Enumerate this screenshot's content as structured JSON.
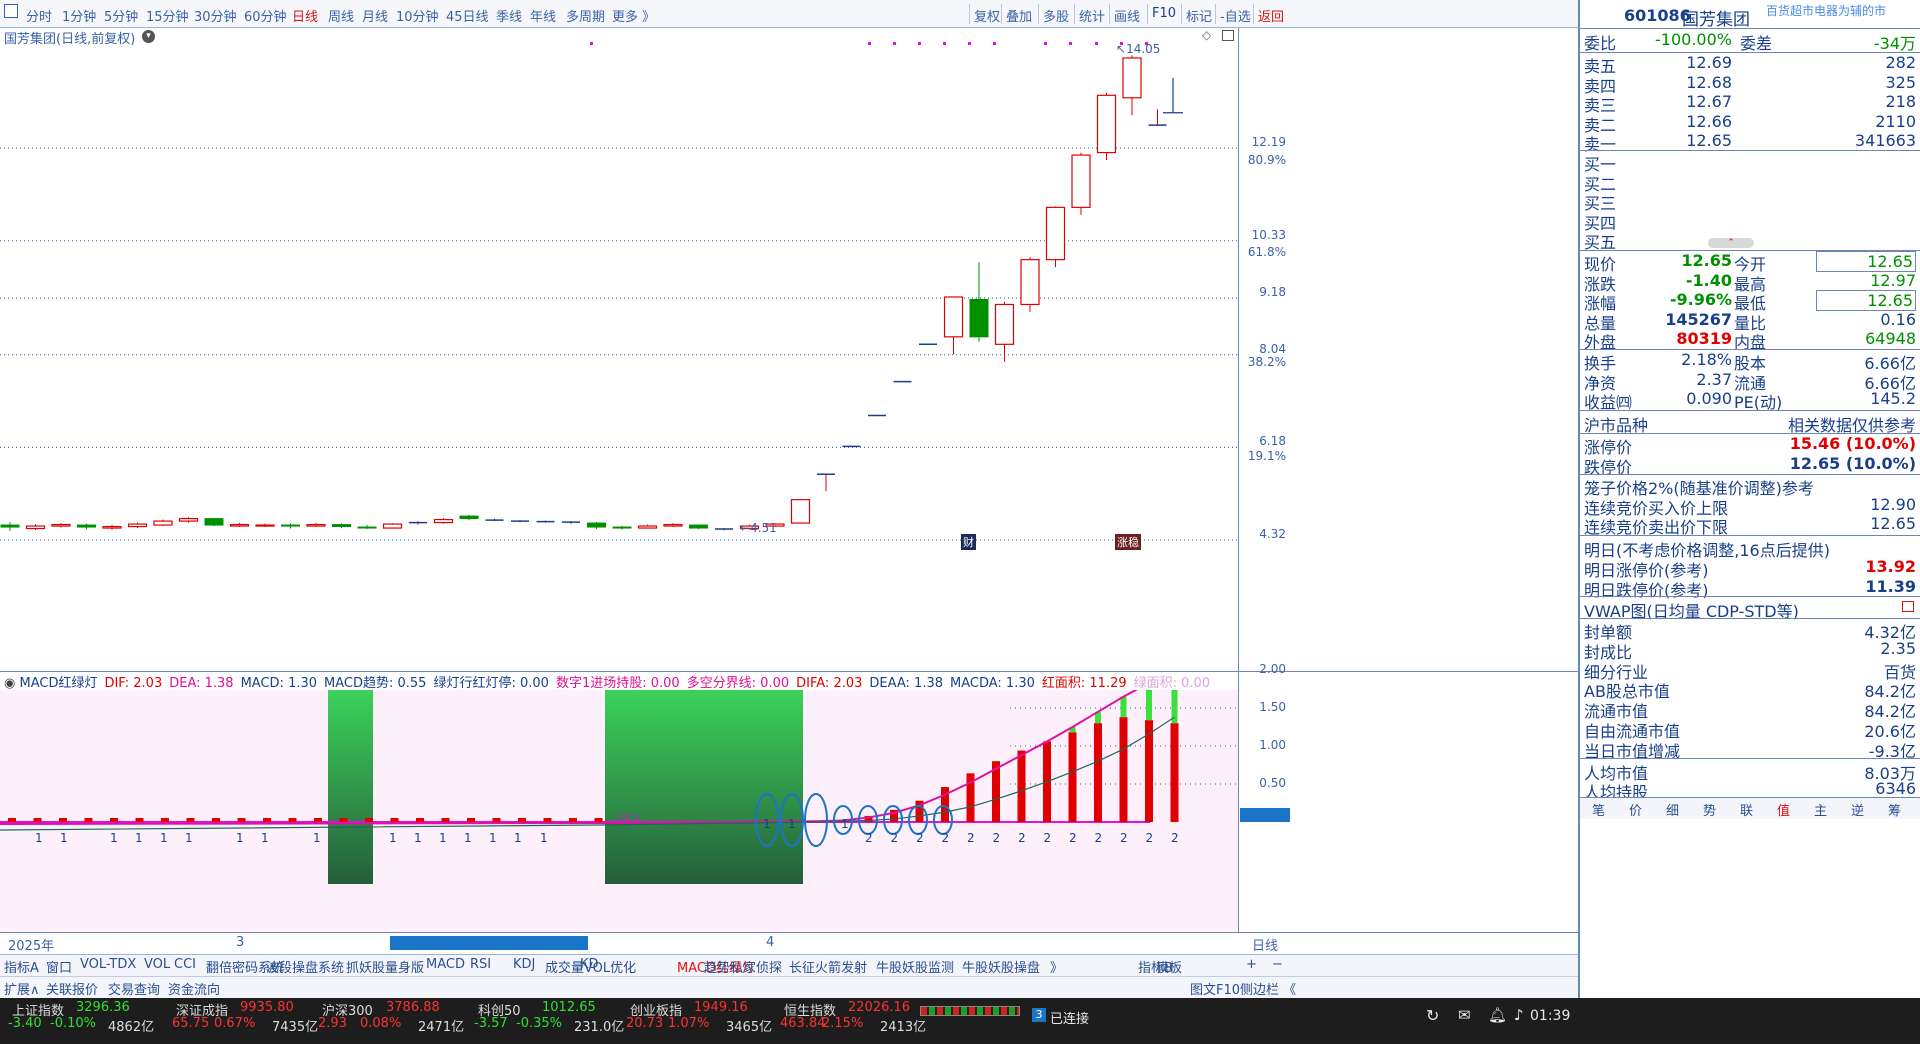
{
  "toolbar": {
    "period_tabs": [
      "分时",
      "1分钟",
      "5分钟",
      "15分钟",
      "30分钟",
      "60分钟",
      "日线",
      "周线",
      "月线",
      "10分钟",
      "45日线",
      "季线",
      "年线",
      "多周期",
      "更多 》"
    ],
    "selected": "日线",
    "right_tabs": [
      "复权",
      "叠加",
      "多股",
      "统计",
      "画线",
      "F10",
      "标记",
      "-自选",
      "返回"
    ]
  },
  "main_chart": {
    "title": "国芳集团(日线,前复权)",
    "price_labels": [
      "12.19",
      "10.33",
      "9.18",
      "8.04",
      "6.18",
      "4.32"
    ],
    "pct_labels": [
      "80.9%",
      "61.8%",
      "38.2%",
      "19.1%"
    ],
    "high_marker": "14.05",
    "low_marker": "4.51",
    "badge_cai": "财",
    "badge_zhang": "涨稳"
  },
  "chart_data": {
    "type": "candlestick",
    "candles": [
      {
        "o": 4.62,
        "c": 4.58,
        "h": 4.68,
        "l": 4.5
      },
      {
        "o": 4.55,
        "c": 4.6,
        "h": 4.64,
        "l": 4.52
      },
      {
        "o": 4.6,
        "c": 4.63,
        "h": 4.66,
        "l": 4.57
      },
      {
        "o": 4.62,
        "c": 4.58,
        "h": 4.65,
        "l": 4.53
      },
      {
        "o": 4.56,
        "c": 4.59,
        "h": 4.62,
        "l": 4.53
      },
      {
        "o": 4.59,
        "c": 4.64,
        "h": 4.67,
        "l": 4.56
      },
      {
        "o": 4.62,
        "c": 4.7,
        "h": 4.73,
        "l": 4.6
      },
      {
        "o": 4.7,
        "c": 4.75,
        "h": 4.78,
        "l": 4.67
      },
      {
        "o": 4.75,
        "c": 4.62,
        "h": 4.76,
        "l": 4.6
      },
      {
        "o": 4.6,
        "c": 4.63,
        "h": 4.66,
        "l": 4.58
      },
      {
        "o": 4.6,
        "c": 4.62,
        "h": 4.65,
        "l": 4.58
      },
      {
        "o": 4.62,
        "c": 4.6,
        "h": 4.65,
        "l": 4.55
      },
      {
        "o": 4.6,
        "c": 4.63,
        "h": 4.66,
        "l": 4.58
      },
      {
        "o": 4.63,
        "c": 4.59,
        "h": 4.65,
        "l": 4.56
      },
      {
        "o": 4.58,
        "c": 4.56,
        "h": 4.62,
        "l": 4.54
      },
      {
        "o": 4.56,
        "c": 4.64,
        "h": 4.66,
        "l": 4.55
      },
      {
        "o": 4.66,
        "c": 4.67,
        "h": 4.7,
        "l": 4.63
      },
      {
        "o": 4.67,
        "c": 4.73,
        "h": 4.76,
        "l": 4.65
      },
      {
        "o": 4.8,
        "c": 4.75,
        "h": 4.83,
        "l": 4.72
      },
      {
        "o": 4.72,
        "c": 4.72,
        "h": 4.75,
        "l": 4.7
      },
      {
        "o": 4.7,
        "c": 4.7,
        "h": 4.72,
        "l": 4.68
      },
      {
        "o": 4.69,
        "c": 4.69,
        "h": 4.71,
        "l": 4.67
      },
      {
        "o": 4.68,
        "c": 4.66,
        "h": 4.7,
        "l": 4.64
      },
      {
        "o": 4.66,
        "c": 4.58,
        "h": 4.68,
        "l": 4.54
      },
      {
        "o": 4.58,
        "c": 4.56,
        "h": 4.6,
        "l": 4.53
      },
      {
        "o": 4.56,
        "c": 4.6,
        "h": 4.63,
        "l": 4.55
      },
      {
        "o": 4.6,
        "c": 4.63,
        "h": 4.66,
        "l": 4.58
      },
      {
        "o": 4.62,
        "c": 4.56,
        "h": 4.63,
        "l": 4.54
      },
      {
        "o": 4.54,
        "c": 4.53,
        "h": 4.56,
        "l": 4.51
      },
      {
        "o": 4.55,
        "c": 4.6,
        "h": 4.63,
        "l": 4.53
      },
      {
        "o": 4.6,
        "c": 4.64,
        "h": 4.66,
        "l": 4.58
      },
      {
        "o": 4.66,
        "c": 5.13,
        "h": 5.13,
        "l": 4.66
      },
      {
        "o": 5.64,
        "c": 5.64,
        "h": 5.64,
        "l": 5.3
      },
      {
        "o": 6.2,
        "c": 6.2,
        "h": 6.2,
        "l": 6.2
      },
      {
        "o": 6.82,
        "c": 6.82,
        "h": 6.82,
        "l": 6.82
      },
      {
        "o": 7.5,
        "c": 7.5,
        "h": 7.5,
        "l": 7.5
      },
      {
        "o": 8.25,
        "c": 8.25,
        "h": 8.25,
        "l": 8.25
      },
      {
        "o": 8.4,
        "c": 9.2,
        "h": 9.2,
        "l": 8.05
      },
      {
        "o": 9.15,
        "c": 8.4,
        "h": 9.9,
        "l": 8.3
      },
      {
        "o": 8.25,
        "c": 9.05,
        "h": 9.1,
        "l": 7.9
      },
      {
        "o": 9.05,
        "c": 9.95,
        "h": 10.0,
        "l": 8.9
      },
      {
        "o": 9.95,
        "c": 11.0,
        "h": 11.02,
        "l": 9.8
      },
      {
        "o": 11.0,
        "c": 12.05,
        "h": 12.1,
        "l": 10.85
      },
      {
        "o": 12.1,
        "c": 13.25,
        "h": 13.3,
        "l": 11.95
      },
      {
        "o": 13.2,
        "c": 14.0,
        "h": 14.05,
        "l": 12.85
      },
      {
        "o": 12.65,
        "c": 12.65,
        "h": 12.97,
        "l": 12.65
      }
    ],
    "ylim": [
      4.32,
      14.2
    ]
  },
  "macd": {
    "title_items": [
      {
        "t": "MACD红绿灯",
        "c": "#1a3f8a"
      },
      {
        "t": "DIF: 2.03",
        "c": "#e00000"
      },
      {
        "t": "DEA: 1.38",
        "c": "#e01090"
      },
      {
        "t": "MACD: 1.30",
        "c": "#1a3f8a"
      },
      {
        "t": "MACD趋势: 0.55",
        "c": "#1a3f8a"
      },
      {
        "t": "绿灯行红灯停: 0.00",
        "c": "#1a3f8a"
      },
      {
        "t": "数字1进场持股: 0.00",
        "c": "#e01090"
      },
      {
        "t": "多空分界线: 0.00",
        "c": "#e01090"
      },
      {
        "t": "DIFA: 2.03",
        "c": "#e00000"
      },
      {
        "t": "DEAA: 1.38",
        "c": "#1a3f8a"
      },
      {
        "t": "MACDA: 1.30",
        "c": "#1a3f8a"
      },
      {
        "t": "红面积: 11.29",
        "c": "#e00000"
      },
      {
        "t": "绿面积: 0.00",
        "c": "#e0a0e0"
      }
    ],
    "y_labels": [
      "2.00",
      "1.50",
      "1.00",
      "0.50"
    ],
    "left_digit_labels": [
      "1",
      "1",
      "1",
      "1",
      "1",
      "1",
      "1",
      "1",
      "1",
      "1",
      "1",
      "1",
      "1",
      "1",
      "1",
      "1"
    ],
    "right_digit_labels": [
      "2",
      "2",
      "2",
      "2",
      "2",
      "2",
      "2",
      "2",
      "2",
      "2",
      "2",
      "2",
      "2"
    ],
    "mid_label": "-152",
    "circle_labels": [
      "1",
      "1",
      "1"
    ],
    "date_labels": [
      "2025年",
      "3",
      "4"
    ],
    "dif_values": [
      0.01,
      0.02,
      0.06,
      0.12,
      0.22,
      0.36,
      0.52,
      0.7,
      0.88,
      1.06,
      1.25,
      1.45,
      1.65,
      1.83,
      2.03
    ],
    "dea_values": [
      0.0,
      0.01,
      0.02,
      0.04,
      0.08,
      0.13,
      0.2,
      0.3,
      0.41,
      0.53,
      0.66,
      0.8,
      0.96,
      1.16,
      1.38
    ],
    "hist_values": [
      0.02,
      0.02,
      0.08,
      0.16,
      0.28,
      0.46,
      0.64,
      0.8,
      0.94,
      1.06,
      1.18,
      1.3,
      1.38,
      1.34,
      1.3
    ]
  },
  "indicator_tabs": [
    "指标A",
    "窗口",
    "VOL-TDX",
    "VOL",
    "CCI",
    "翻倍密码系统",
    "波段操盘系统",
    "抓妖股量身版",
    "MACD",
    "RSI",
    "KDJ",
    "成交量VOL优化",
    "KD",
    "MACD红绿灯",
    "趋势私家侦探",
    "长征火箭发射",
    "牛股妖股监测",
    "牛股妖股操盘",
    "》",
    "指标B",
    "模板"
  ],
  "indicator_selected": "MACD红绿灯",
  "period_indicator": "日线",
  "ext_tabs": [
    "扩展∧",
    "关联报价",
    "交易查询",
    "资金流向"
  ],
  "ext_right": [
    "图文F10",
    "侧边栏 《"
  ],
  "plus_minus": [
    "+",
    "−"
  ],
  "right_panel": {
    "code": "601086",
    "name": "国芳集团",
    "scroll_text": "百货超市电器为辅的市",
    "webi_label": "委比",
    "webi_val": "-100.00%",
    "weicha_label": "委差",
    "weicha_val": "-34万",
    "sells": [
      {
        "l": "卖五",
        "p": "12.69",
        "v": "282"
      },
      {
        "l": "卖四",
        "p": "12.68",
        "v": "325"
      },
      {
        "l": "卖三",
        "p": "12.67",
        "v": "218"
      },
      {
        "l": "卖二",
        "p": "12.66",
        "v": "2110"
      },
      {
        "l": "卖一",
        "p": "12.65",
        "v": "341663"
      }
    ],
    "buys": [
      "买一",
      "买二",
      "买三",
      "买四",
      "买五"
    ],
    "quote": [
      {
        "l1": "现价",
        "v1": "12.65",
        "l2": "今开",
        "v2": "12.65",
        "c1": "grn",
        "c2": "grn"
      },
      {
        "l1": "涨跌",
        "v1": "-1.40",
        "l2": "最高",
        "v2": "12.97",
        "c1": "grn",
        "c2": "grn"
      },
      {
        "l1": "涨幅",
        "v1": "-9.96%",
        "l2": "最低",
        "v2": "12.65",
        "c1": "grn",
        "c2": "grn"
      },
      {
        "l1": "总量",
        "v1": "145267",
        "l2": "量比",
        "v2": "0.16",
        "c1": "blu",
        "c2": "blu"
      },
      {
        "l1": "外盘",
        "v1": "80319",
        "l2": "内盘",
        "v2": "64948",
        "c1": "red",
        "c2": "grn"
      }
    ],
    "fund": [
      {
        "l1": "换手",
        "v1": "2.18%",
        "l2": "股本",
        "v2": "6.66亿"
      },
      {
        "l1": "净资",
        "v1": "2.37",
        "l2": "流通",
        "v2": "6.66亿"
      },
      {
        "l1": "收益㈣",
        "v1": "0.090",
        "l2": "PE(动)",
        "v2": "145.2"
      }
    ],
    "market_label": "沪市品种",
    "market_note": "相关数据仅供参考",
    "limit_up_label": "涨停价",
    "limit_up_val": "15.46 (10.0%)",
    "limit_dn_label": "跌停价",
    "limit_dn_val": "12.65 (10.0%)",
    "cage_title": "笼子价格2%(随基准价调整)参考",
    "cage_buy_label": "连续竞价买入价上限",
    "cage_buy_val": "12.90",
    "cage_sell_label": "连续竞价卖出价下限",
    "cage_sell_val": "12.65",
    "tomorrow_title": "明日(不考虑价格调整,16点后提供)",
    "tmr_up_label": "明日涨停价(参考)",
    "tmr_up_val": "13.92",
    "tmr_dn_label": "明日跌停价(参考)",
    "tmr_dn_val": "11.39",
    "vwap_title": "VWAP图(日均量 CDP-STD等)",
    "stats": [
      {
        "l": "封单额",
        "v": "4.32亿"
      },
      {
        "l": "封成比",
        "v": "2.35"
      },
      {
        "l": "细分行业",
        "v": "百货"
      },
      {
        "l": "AB股总市值",
        "v": "84.2亿"
      },
      {
        "l": "流通市值",
        "v": "84.2亿"
      },
      {
        "l": "自由流通市值",
        "v": "20.6亿"
      },
      {
        "l": "当日市值增减",
        "v": "-9.3亿"
      },
      {
        "l": "人均市值",
        "v": "8.03万"
      },
      {
        "l": "人均持股",
        "v": "6346"
      }
    ],
    "bottom_tabs": [
      "笔",
      "价",
      "细",
      "势",
      "联",
      "值",
      "主",
      "逆",
      "筹"
    ],
    "bottom_selected": "值"
  },
  "status": {
    "indices": [
      {
        "name": "上证指数",
        "val": "3296.36",
        "chg": "-3.40",
        "pct": "-0.10%",
        "amt": "4862亿",
        "up": false
      },
      {
        "name": "深证成指",
        "val": "9935.80",
        "chg": "65.75",
        "pct": "0.67%",
        "amt": "7435亿",
        "up": true
      },
      {
        "name": "沪深300",
        "val": "3786.88",
        "chg": "2.93",
        "pct": "0.08%",
        "amt": "2471亿",
        "up": true
      },
      {
        "name": "科创50",
        "val": "1012.65",
        "chg": "-3.57",
        "pct": "-0.35%",
        "amt": "231.0亿",
        "up": false
      },
      {
        "name": "创业板指",
        "val": "1949.16",
        "chg": "20.73",
        "pct": "1.07%",
        "amt": "3465亿",
        "up": true
      },
      {
        "name": "恒生指数",
        "val": "22026.16",
        "chg": "463.84",
        "pct": "2.15%",
        "amt": "2413亿",
        "up": true
      }
    ],
    "conn_num": "3",
    "conn_text": "已连接",
    "time": "01:39"
  }
}
